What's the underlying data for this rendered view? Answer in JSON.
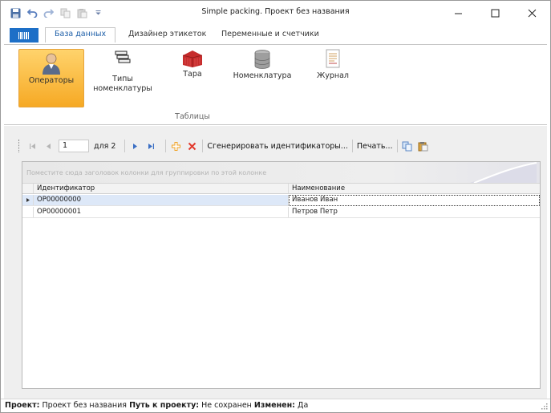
{
  "window": {
    "title": "Simple packing. Проект без названия"
  },
  "quick_access": [
    "save-icon",
    "undo-icon",
    "redo-icon",
    "copy-icon",
    "paste-icon",
    "customize-dropdown-icon"
  ],
  "tabs": [
    {
      "label": "База данных",
      "active": true
    },
    {
      "label": "Дизайнер этикеток",
      "active": false
    },
    {
      "label": "Переменные и счетчики",
      "active": false
    }
  ],
  "ribbon": {
    "buttons": [
      {
        "label": "Операторы",
        "icon": "operator-icon",
        "selected": true
      },
      {
        "label": "Типы номенклатуры",
        "icon": "item-types-icon",
        "selected": false
      },
      {
        "label": "Тара",
        "icon": "container-icon",
        "selected": false
      },
      {
        "label": "Номенклатура",
        "icon": "database-icon",
        "selected": false
      },
      {
        "label": "Журнал",
        "icon": "journal-icon",
        "selected": false
      }
    ],
    "group_label": "Таблицы"
  },
  "navigator": {
    "position": "1",
    "of_text": "для 2",
    "generate_label": "Сгенерировать идентификаторы...",
    "print_label": "Печать..."
  },
  "grid": {
    "group_hint": "Поместите сюда заголовок колонки для группировки по этой колонке",
    "columns": [
      "Идентификатор",
      "Наименование"
    ],
    "rows": [
      {
        "id": "OP00000000",
        "name": "Иванов Иван",
        "selected": true
      },
      {
        "id": "OP00000001",
        "name": "Петров Петр",
        "selected": false
      }
    ]
  },
  "status": {
    "project_label": "Проект:",
    "project_value": "Проект без названия",
    "path_label": "Путь к проекту:",
    "path_value": "Не сохранен",
    "changed_label": "Изменен:",
    "changed_value": "Да"
  },
  "colors": {
    "accent": "#1d6fc7",
    "selected_button": "#f6a924",
    "delete": "#e23b2e",
    "add": "#f0a020"
  }
}
